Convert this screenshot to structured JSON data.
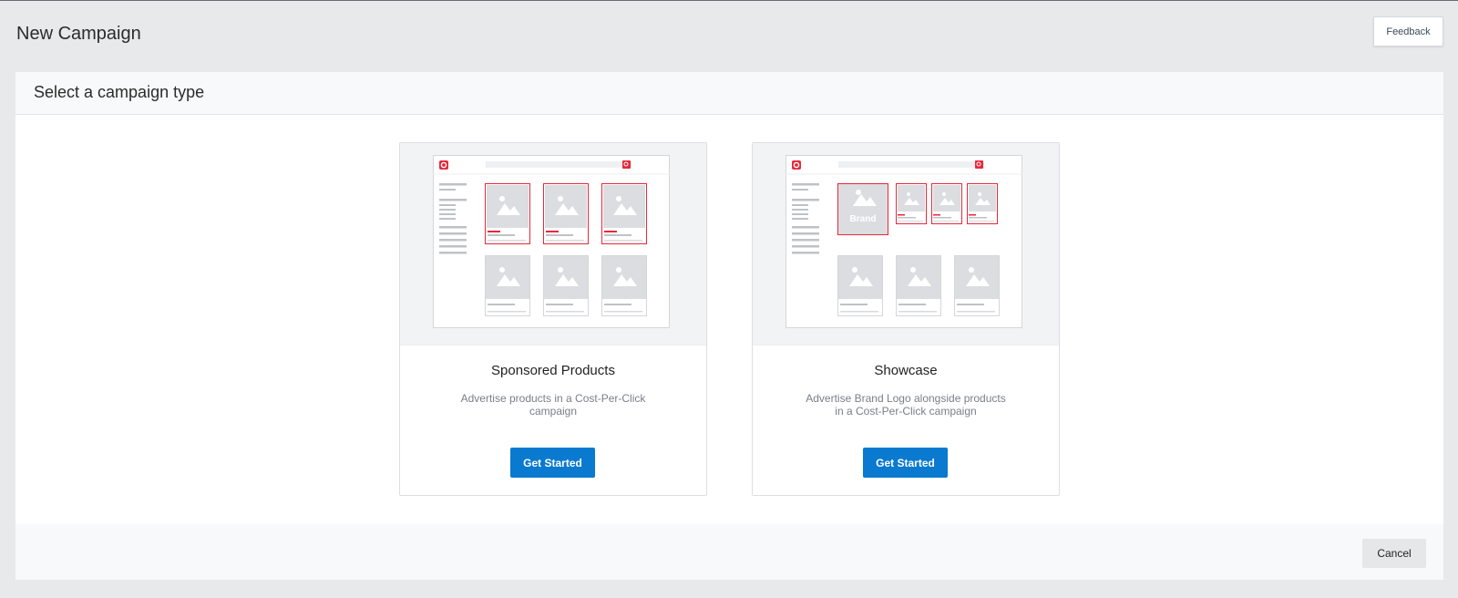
{
  "page": {
    "title": "New Campaign",
    "feedback_label": "Feedback"
  },
  "panel": {
    "title": "Select a campaign type",
    "cancel_label": "Cancel"
  },
  "cards": [
    {
      "title": "Sponsored Products",
      "description": "Advertise products in a Cost-Per-Click campaign",
      "button_label": "Get Started"
    },
    {
      "title": "Showcase",
      "description": "Advertise Brand Logo alongside products in a Cost-Per-Click campaign",
      "button_label": "Get Started",
      "preview_brand_label": "Brand"
    }
  ],
  "colors": {
    "accent": "#0a7ad0",
    "highlight": "#e8283a"
  }
}
